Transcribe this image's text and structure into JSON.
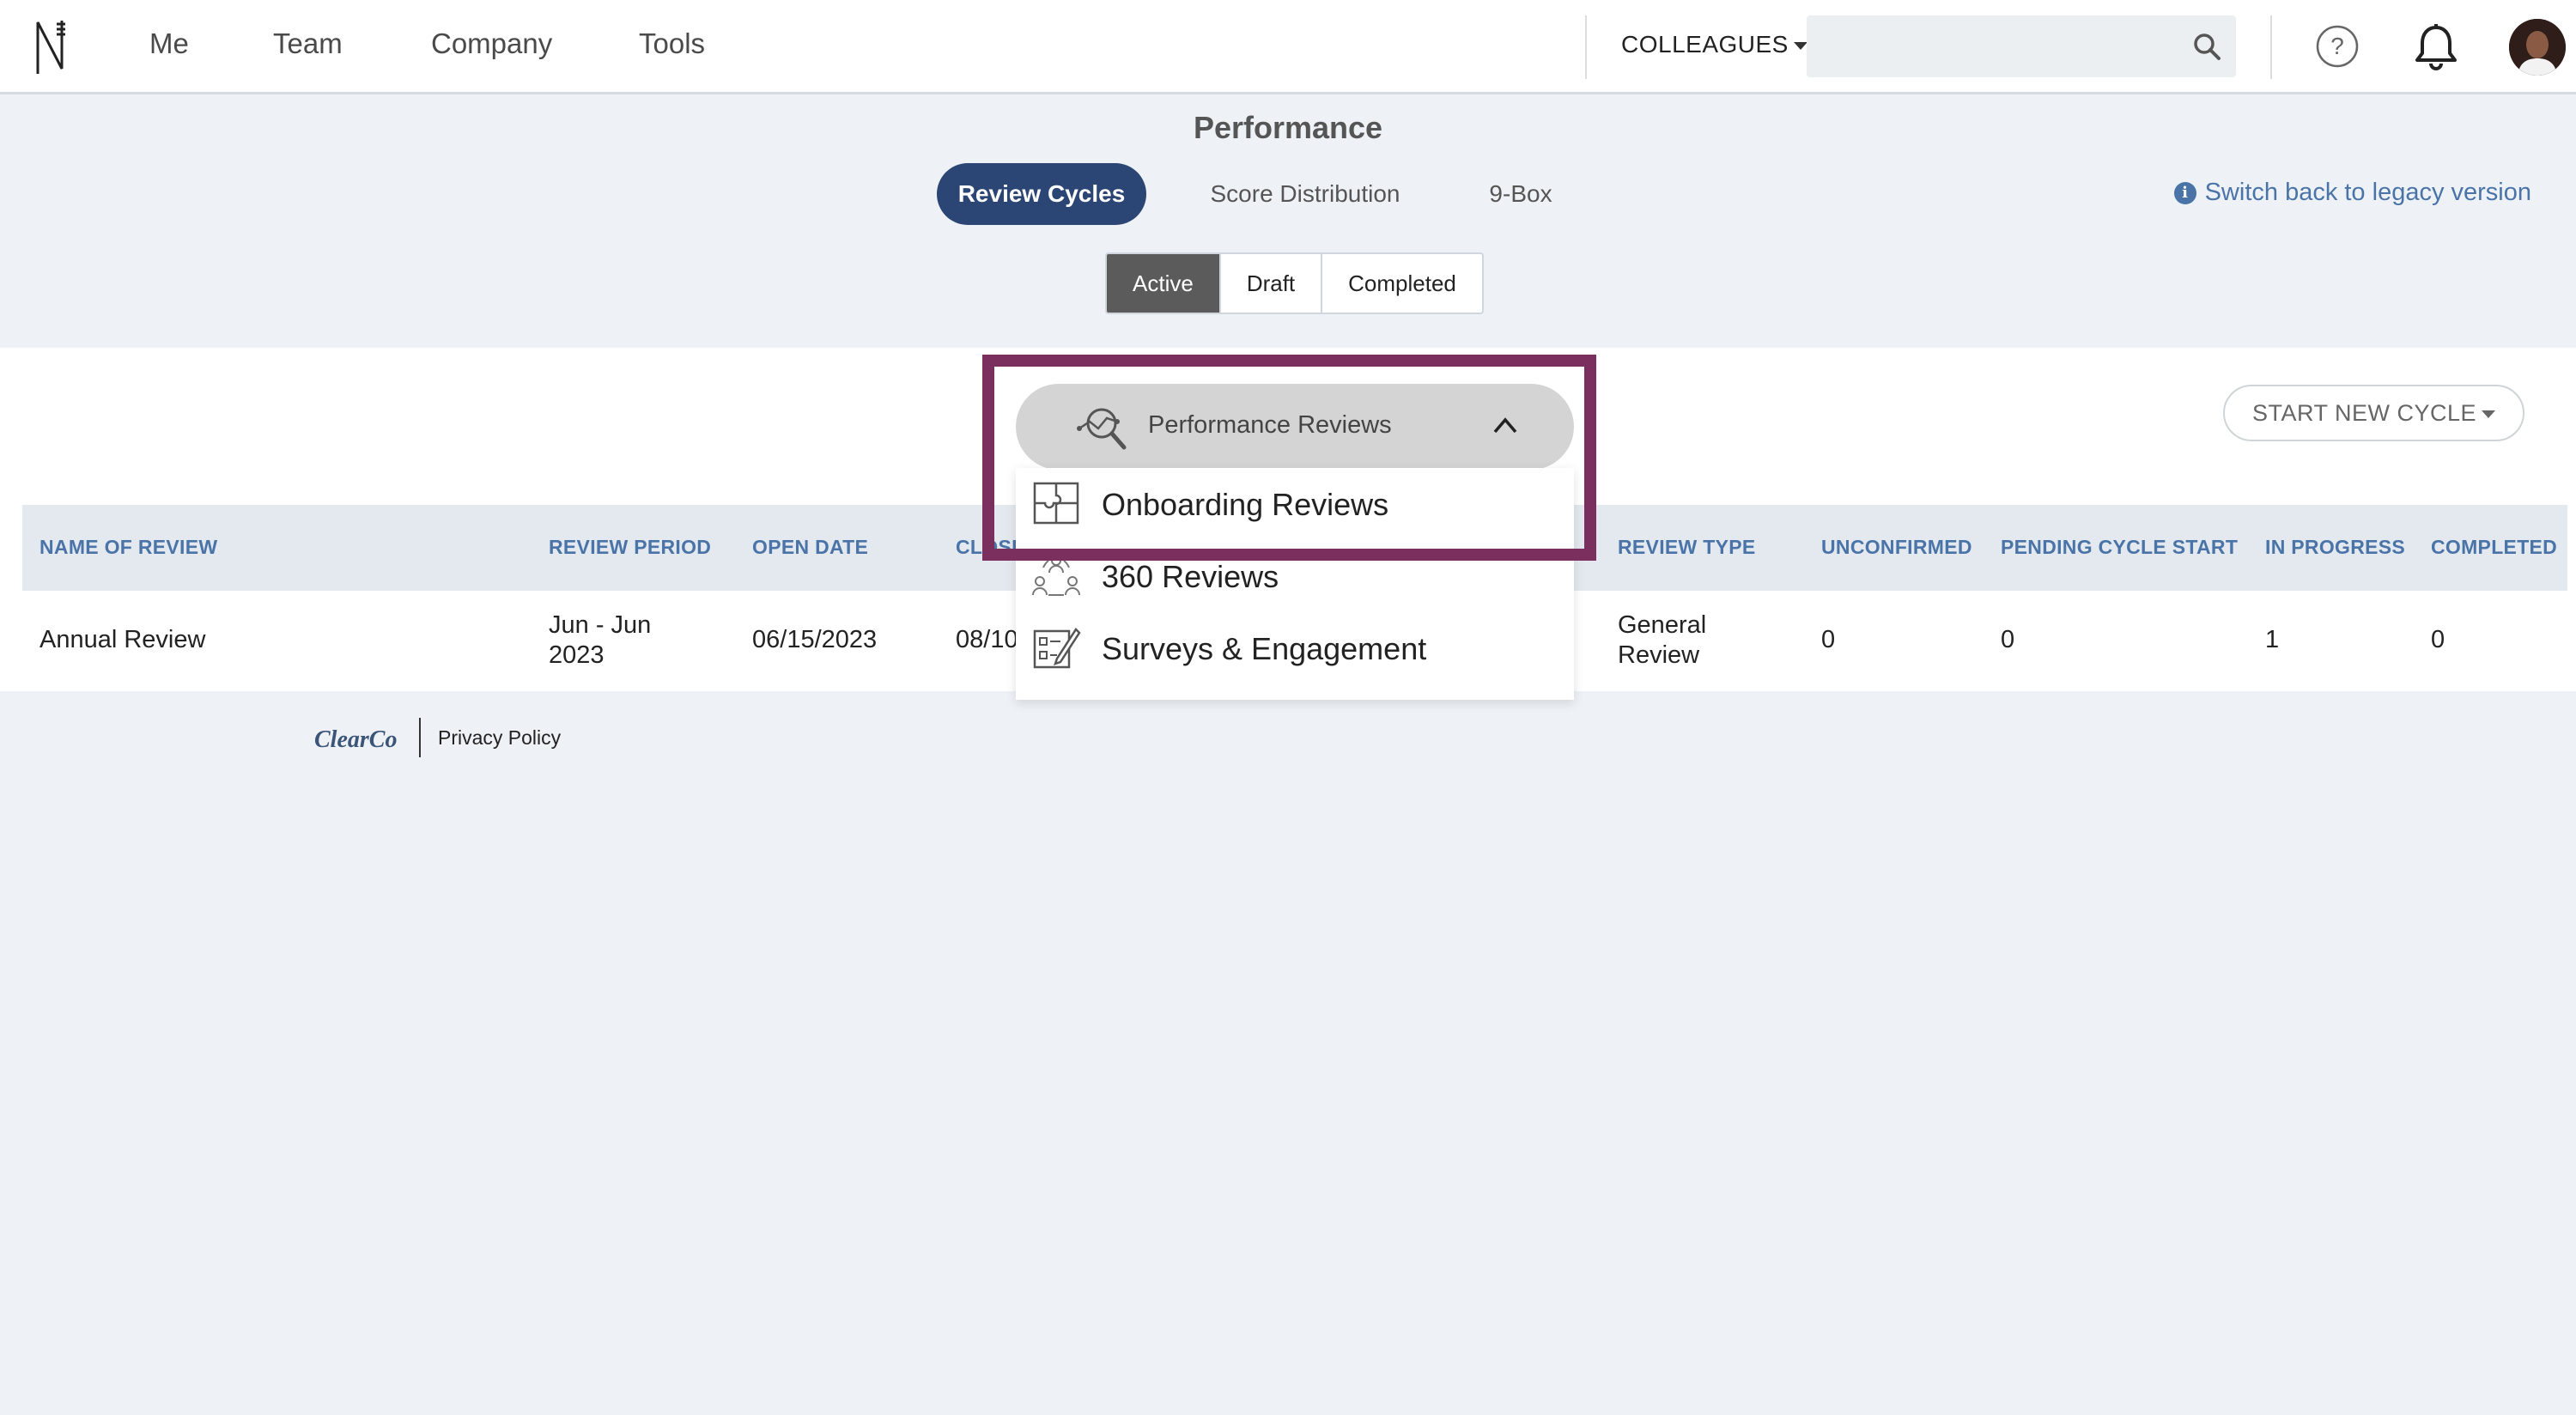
{
  "nav": {
    "items": [
      "Me",
      "Team",
      "Company",
      "Tools"
    ],
    "colleagues_label": "COLLEAGUES",
    "search": {
      "value": "",
      "placeholder": ""
    }
  },
  "page": {
    "title": "Performance",
    "tabs": [
      "Review Cycles",
      "Score Distribution",
      "9-Box"
    ],
    "active_tab": "Review Cycles",
    "legacy_link": "Switch back to legacy version",
    "status_filters": [
      "Active",
      "Draft",
      "Completed"
    ],
    "active_filter": "Active",
    "start_button": "START NEW CYCLE"
  },
  "dropdown": {
    "selected": "Performance Reviews",
    "options": [
      "Onboarding Reviews",
      "360 Reviews",
      "Surveys & Engagement"
    ]
  },
  "table": {
    "headers": [
      "NAME OF REVIEW",
      "REVIEW PERIOD",
      "OPEN DATE",
      "CLOSE DATE",
      "REVIEW TYPE",
      "UNCONFIRMED",
      "PENDING CYCLE START",
      "IN PROGRESS",
      "COMPLETED"
    ],
    "rows": [
      {
        "name": "Annual Review",
        "period_line1": "Jun - Jun",
        "period_line2": "2023",
        "open_date": "06/15/2023",
        "close_date": "08/10",
        "type_line1": "General",
        "type_line2": "Review",
        "unconfirmed": "0",
        "pending": "0",
        "in_progress": "1",
        "completed": "0"
      }
    ]
  },
  "footer": {
    "brand": "ClearCo",
    "privacy": "Privacy Policy"
  },
  "colors": {
    "primary": "#2b4574",
    "link": "#4a74a8",
    "highlight": "#7a2f5e"
  }
}
